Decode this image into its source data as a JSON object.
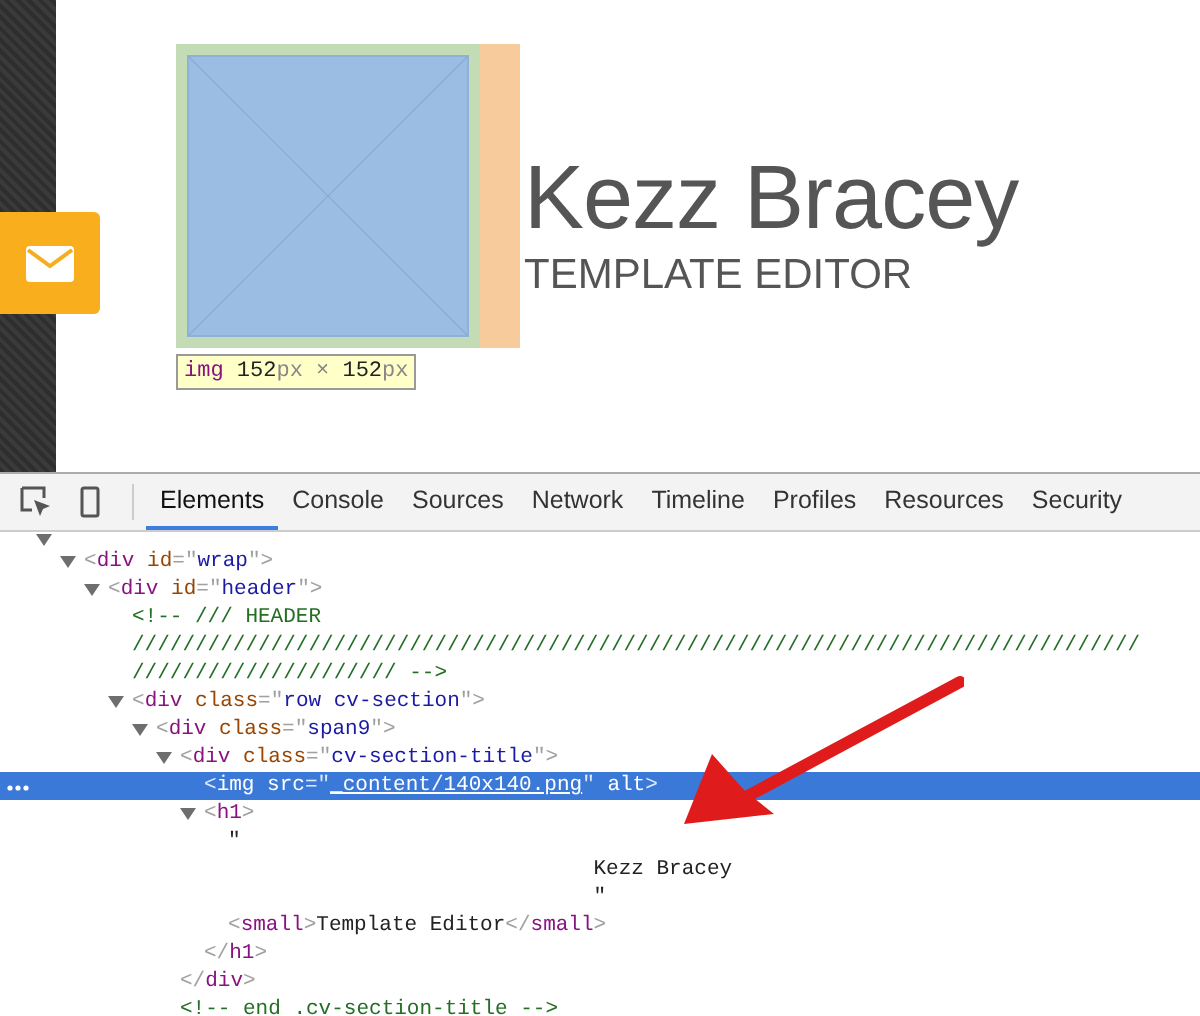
{
  "page": {
    "name": "Kezz Bracey",
    "subtitle": "TEMPLATE EDITOR",
    "inspector_tooltip": [
      {
        "kind": "tag",
        "text": "img"
      },
      {
        "kind": "number",
        "text": " 152"
      },
      {
        "kind": "unit",
        "text": "px"
      },
      {
        "kind": "unit",
        "text": " × "
      },
      {
        "kind": "number",
        "text": "152"
      },
      {
        "kind": "unit",
        "text": "px"
      }
    ]
  },
  "devtools": {
    "tabs": [
      {
        "label": "Elements",
        "selected": true
      },
      {
        "label": "Console",
        "selected": false
      },
      {
        "label": "Sources",
        "selected": false
      },
      {
        "label": "Network",
        "selected": false
      },
      {
        "label": "Timeline",
        "selected": false
      },
      {
        "label": "Profiles",
        "selected": false
      },
      {
        "label": "Resources",
        "selected": false
      },
      {
        "label": "Security",
        "selected": false
      }
    ],
    "tree": [
      {
        "kind": "toggle",
        "expanded": true,
        "selected": false,
        "children": [
          {
            "kind": "toggle",
            "expanded": true,
            "selected": false,
            "tokens": [
              {
                "kind": "punct",
                "text": "<"
              },
              {
                "kind": "tag",
                "text": "div "
              },
              {
                "kind": "attr",
                "text": "id"
              },
              {
                "kind": "punct",
                "text": "=\""
              },
              {
                "kind": "value",
                "text": "wrap"
              },
              {
                "kind": "punct",
                "text": "\">"
              }
            ],
            "children": [
              {
                "kind": "toggle",
                "expanded": true,
                "selected": false,
                "tokens": [
                  {
                    "kind": "punct",
                    "text": "<"
                  },
                  {
                    "kind": "tag",
                    "text": "div "
                  },
                  {
                    "kind": "attr",
                    "text": "id"
                  },
                  {
                    "kind": "punct",
                    "text": "=\""
                  },
                  {
                    "kind": "value",
                    "text": "header"
                  },
                  {
                    "kind": "punct",
                    "text": "\">"
                  }
                ],
                "children": [
                  {
                    "kind": "leaf",
                    "selected": false,
                    "tokens": [
                      {
                        "kind": "comment",
                        "text": "<!-- /// HEADER\n////////////////////////////////////////////////////////////////////////////////\n///////////////////// -->"
                      }
                    ]
                  },
                  {
                    "kind": "toggle",
                    "expanded": true,
                    "selected": false,
                    "tokens": [
                      {
                        "kind": "punct",
                        "text": "<"
                      },
                      {
                        "kind": "tag",
                        "text": "div "
                      },
                      {
                        "kind": "attr",
                        "text": "class"
                      },
                      {
                        "kind": "punct",
                        "text": "=\""
                      },
                      {
                        "kind": "value",
                        "text": "row cv-section"
                      },
                      {
                        "kind": "punct",
                        "text": "\">"
                      }
                    ],
                    "children": [
                      {
                        "kind": "toggle",
                        "expanded": true,
                        "selected": false,
                        "tokens": [
                          {
                            "kind": "punct",
                            "text": "<"
                          },
                          {
                            "kind": "tag",
                            "text": "div "
                          },
                          {
                            "kind": "attr",
                            "text": "class"
                          },
                          {
                            "kind": "punct",
                            "text": "=\""
                          },
                          {
                            "kind": "value",
                            "text": "span9"
                          },
                          {
                            "kind": "punct",
                            "text": "\">"
                          }
                        ],
                        "children": [
                          {
                            "kind": "toggle",
                            "expanded": true,
                            "selected": false,
                            "tokens": [
                              {
                                "kind": "punct",
                                "text": "<"
                              },
                              {
                                "kind": "tag",
                                "text": "div "
                              },
                              {
                                "kind": "attr",
                                "text": "class"
                              },
                              {
                                "kind": "punct",
                                "text": "=\""
                              },
                              {
                                "kind": "value",
                                "text": "cv-section-title"
                              },
                              {
                                "kind": "punct",
                                "text": "\">"
                              }
                            ],
                            "children": [
                              {
                                "kind": "leaf",
                                "selected": true,
                                "tokens": [
                                  {
                                    "kind": "punct",
                                    "text": "<"
                                  },
                                  {
                                    "kind": "tag",
                                    "text": "img "
                                  },
                                  {
                                    "kind": "attr",
                                    "text": "src"
                                  },
                                  {
                                    "kind": "punct",
                                    "text": "=\""
                                  },
                                  {
                                    "kind": "link",
                                    "text": "_content/140x140.png"
                                  },
                                  {
                                    "kind": "punct",
                                    "text": "\" "
                                  },
                                  {
                                    "kind": "attr",
                                    "text": "alt"
                                  },
                                  {
                                    "kind": "punct",
                                    "text": ">"
                                  }
                                ]
                              },
                              {
                                "kind": "toggle",
                                "expanded": true,
                                "selected": false,
                                "tokens": [
                                  {
                                    "kind": "punct",
                                    "text": "<"
                                  },
                                  {
                                    "kind": "tag",
                                    "text": "h1"
                                  },
                                  {
                                    "kind": "punct",
                                    "text": ">"
                                  }
                                ],
                                "children": [
                                  {
                                    "kind": "leaf",
                                    "selected": false,
                                    "tokens": [
                                      {
                                        "kind": "text",
                                        "text": "\"\n                             Kezz Bracey\n                             \""
                                      }
                                    ]
                                  },
                                  {
                                    "kind": "leaf",
                                    "selected": false,
                                    "tokens": [
                                      {
                                        "kind": "punct",
                                        "text": "<"
                                      },
                                      {
                                        "kind": "tag",
                                        "text": "small"
                                      },
                                      {
                                        "kind": "punct",
                                        "text": ">"
                                      },
                                      {
                                        "kind": "text",
                                        "text": "Template Editor"
                                      },
                                      {
                                        "kind": "punct",
                                        "text": "</"
                                      },
                                      {
                                        "kind": "tag",
                                        "text": "small"
                                      },
                                      {
                                        "kind": "punct",
                                        "text": ">"
                                      }
                                    ]
                                  }
                                ]
                              },
                              {
                                "kind": "leaf",
                                "selected": false,
                                "tokens": [
                                  {
                                    "kind": "punct",
                                    "text": "</"
                                  },
                                  {
                                    "kind": "tag",
                                    "text": "h1"
                                  },
                                  {
                                    "kind": "punct",
                                    "text": ">"
                                  }
                                ]
                              }
                            ]
                          },
                          {
                            "kind": "leaf",
                            "selected": false,
                            "tokens": [
                              {
                                "kind": "punct",
                                "text": "</"
                              },
                              {
                                "kind": "tag",
                                "text": "div"
                              },
                              {
                                "kind": "punct",
                                "text": ">"
                              }
                            ]
                          },
                          {
                            "kind": "leaf",
                            "selected": false,
                            "tokens": [
                              {
                                "kind": "comment",
                                "text": "<!-- end .cv-section-title -->"
                              }
                            ]
                          }
                        ]
                      }
                    ]
                  }
                ]
              }
            ]
          }
        ]
      }
    ]
  }
}
